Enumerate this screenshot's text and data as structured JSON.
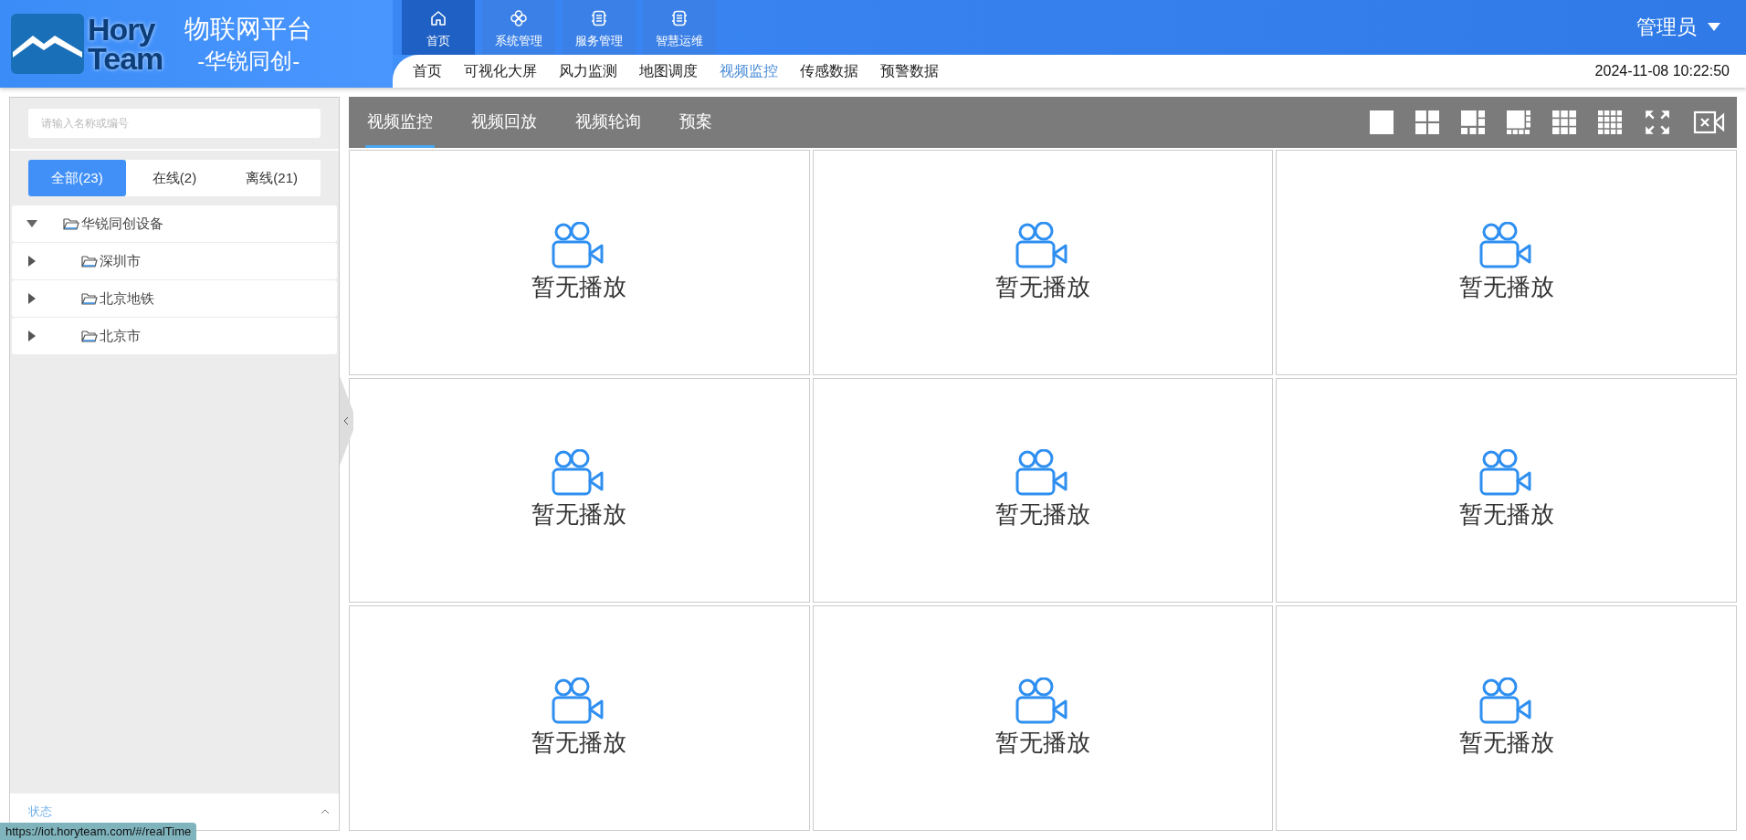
{
  "brand": {
    "logo_top": "Hory",
    "logo_bottom": "Team",
    "title": "物联网平台",
    "subtitle": "-华锐同创-"
  },
  "top_nav": [
    {
      "label": "首页",
      "kind": "home",
      "selected": true
    },
    {
      "label": "系统管理",
      "kind": "flower",
      "selected": false
    },
    {
      "label": "服务管理",
      "kind": "list",
      "selected": false
    },
    {
      "label": "智慧运维",
      "kind": "list",
      "selected": false
    }
  ],
  "user": {
    "name": "管理员"
  },
  "sub_nav": [
    {
      "label": "首页",
      "selected": false
    },
    {
      "label": "可视化大屏",
      "selected": false
    },
    {
      "label": "风力监测",
      "selected": false
    },
    {
      "label": "地图调度",
      "selected": false
    },
    {
      "label": "视频监控",
      "selected": true
    },
    {
      "label": "传感数据",
      "selected": false
    },
    {
      "label": "预警数据",
      "selected": false
    }
  ],
  "clock": "2024-11-08 10:22:50",
  "sidebar": {
    "search": {
      "placeholder": "请输入名称或编号"
    },
    "filters": [
      {
        "label": "全部(23)",
        "selected": true
      },
      {
        "label": "在线(2)",
        "selected": false
      },
      {
        "label": "离线(21)",
        "selected": false
      }
    ],
    "tree": [
      {
        "label": "华锐同创设备",
        "expanded": true,
        "children": [
          {
            "label": "深圳市",
            "expanded": false
          },
          {
            "label": "北京地铁",
            "expanded": false
          },
          {
            "label": "北京市",
            "expanded": false
          }
        ]
      }
    ],
    "status_panel": {
      "label": "状态",
      "expanded": false
    }
  },
  "video_tabs": [
    {
      "label": "视频监控",
      "selected": true
    },
    {
      "label": "视频回放",
      "selected": false
    },
    {
      "label": "视频轮询",
      "selected": false
    },
    {
      "label": "预案",
      "selected": false
    }
  ],
  "layout_tools": [
    {
      "kind": "grid1"
    },
    {
      "kind": "grid4"
    },
    {
      "kind": "grid6"
    },
    {
      "kind": "grid8"
    },
    {
      "kind": "grid9"
    },
    {
      "kind": "grid16"
    },
    {
      "kind": "fullscreen"
    },
    {
      "kind": "close-video"
    }
  ],
  "video_cells": [
    {
      "text": "暂无播放"
    },
    {
      "text": "暂无播放"
    },
    {
      "text": "暂无播放"
    },
    {
      "text": "暂无播放"
    },
    {
      "text": "暂无播放"
    },
    {
      "text": "暂无播放"
    },
    {
      "text": "暂无播放"
    },
    {
      "text": "暂无播放"
    },
    {
      "text": "暂无播放"
    }
  ],
  "status_url": "https://iot.horyteam.com/#/realTime"
}
